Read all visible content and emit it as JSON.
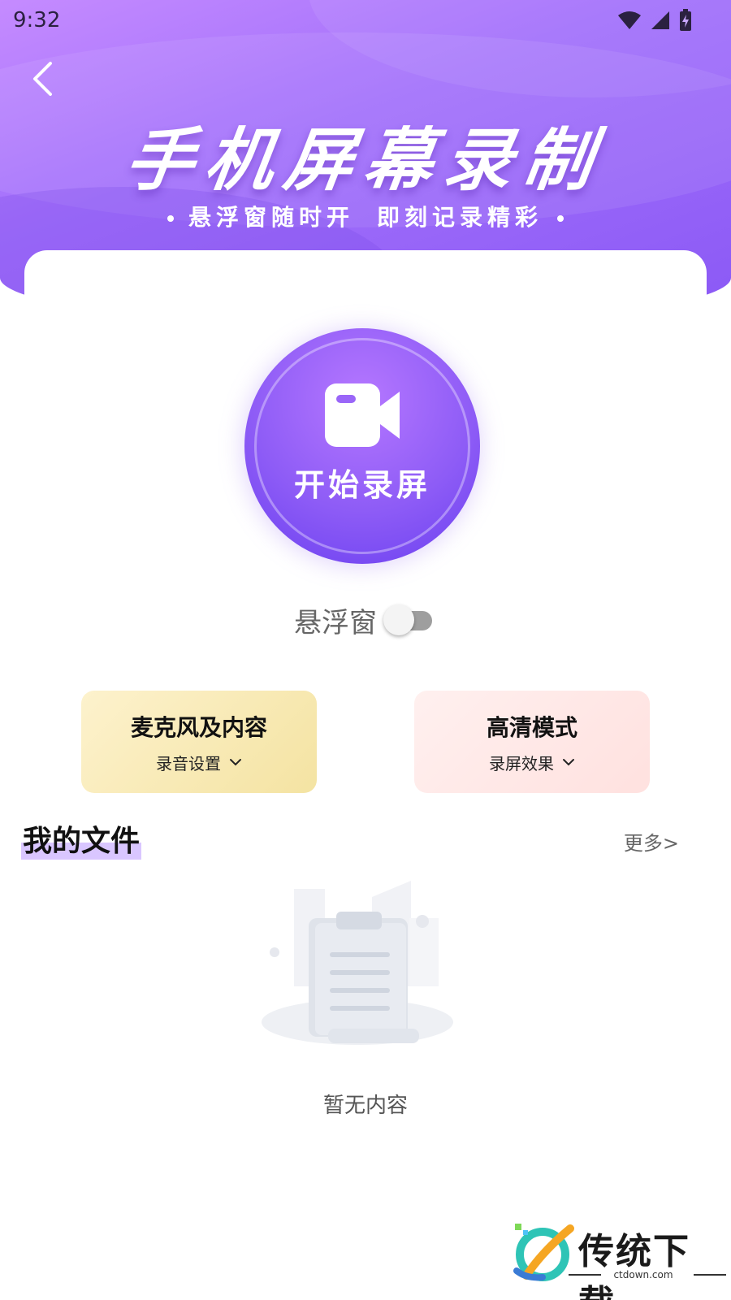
{
  "status_bar": {
    "time": "9:32"
  },
  "header": {
    "title": "手机屏幕录制",
    "subtitle_left": "悬浮窗随时开",
    "subtitle_right": "即刻记录精彩"
  },
  "record": {
    "label": "开始录屏"
  },
  "floating_window": {
    "label": "悬浮窗",
    "enabled": false
  },
  "features": [
    {
      "title": "麦克风及内容",
      "subtitle": "录音设置"
    },
    {
      "title": "高清模式",
      "subtitle": "录屏效果"
    }
  ],
  "files": {
    "title": "我的文件",
    "more": "更多>",
    "empty_text": "暂无内容"
  },
  "watermark": {
    "brand": "传统下载",
    "domain": "ctdown.com"
  },
  "colors": {
    "banner_start": "#c58bff",
    "banner_end": "#8a58f5",
    "record_button": "#8e5cf6",
    "mic_card": "#f4e3a2",
    "hd_card": "#ffe1df"
  }
}
